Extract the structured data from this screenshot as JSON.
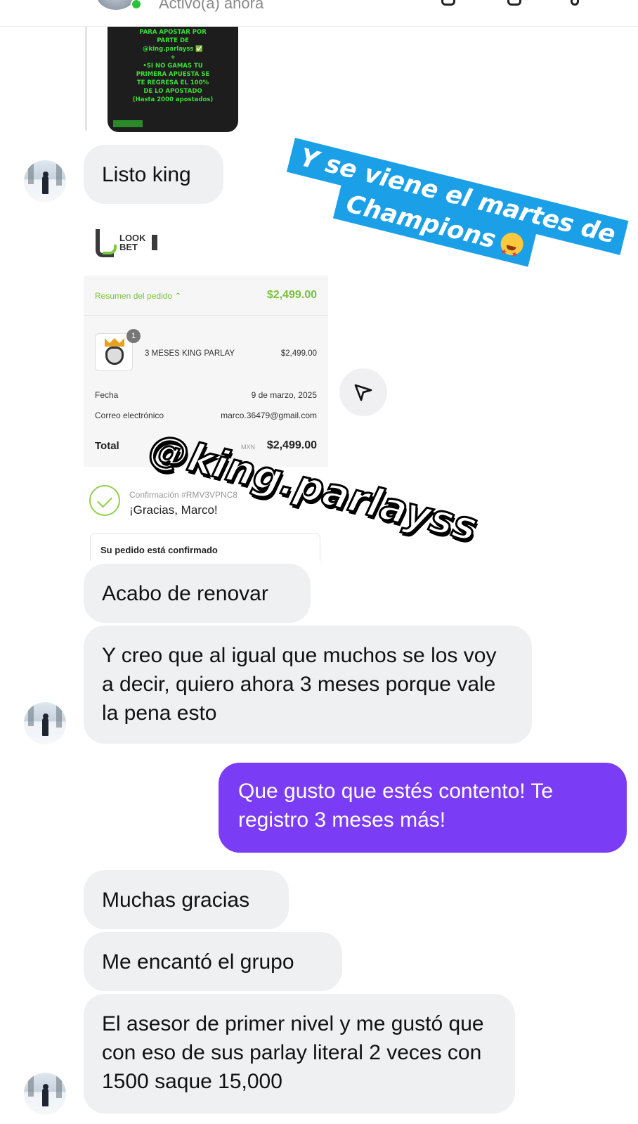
{
  "header": {
    "status": "Activo(a) ahora"
  },
  "promo_post": {
    "lines": [
      "PARA APOSTAR POR",
      "PARTE DE",
      "@king.parlayss ✅",
      "+",
      "•SI NO GAMAS TU",
      "PRIMERA APUESTA SE",
      "TE REGRESA EL 100%",
      "DE LO APOSTADO",
      "(Hasta 2000 apostados)"
    ]
  },
  "messages": {
    "m1": "Listo king",
    "m2": "Acabo de renovar",
    "m3": "Y creo que al igual que muchos se los voy a decir, quiero ahora 3 meses porque vale la pena esto",
    "m4": "Que gusto que estés contento! Te registro 3 meses más!",
    "m5": "Muchas gracias",
    "m6": "Me encantó el grupo",
    "m7": "El asesor de primer nivel y me gustó que con eso de sus parlay literal 2 veces con 1500 saque 15,000"
  },
  "receipt": {
    "logo_text_1": "LOOK",
    "logo_text_2": "BET",
    "summary_label": "Resumen del pedido ⌃",
    "summary_total": "$2,499.00",
    "item_qty": "1",
    "item_name": "3 MESES KING PARLAY",
    "item_price": "$2,499.00",
    "date_label": "Fecha",
    "date_value": "9 de marzo, 2025",
    "email_label": "Correo electrónico",
    "email_value": "marco.36479@gmail.com",
    "total_label": "Total",
    "currency": "MXN",
    "total_value": "$2,499.00",
    "confirmation_label": "Confirmación #RMV3VPNC8",
    "thanks": "¡Gracias, Marco!",
    "confirmed": "Su pedido está confirmado"
  },
  "stickers": {
    "champions_line1": "Y se viene el martes de",
    "champions_line2": "Champions",
    "handle": "@king.parlayss"
  },
  "colors": {
    "outgoing_bubble": "#7b3cf6",
    "incoming_bubble": "#eff0f2",
    "sticker_blue": "#1ba0e8",
    "receipt_green": "#79c23b"
  }
}
